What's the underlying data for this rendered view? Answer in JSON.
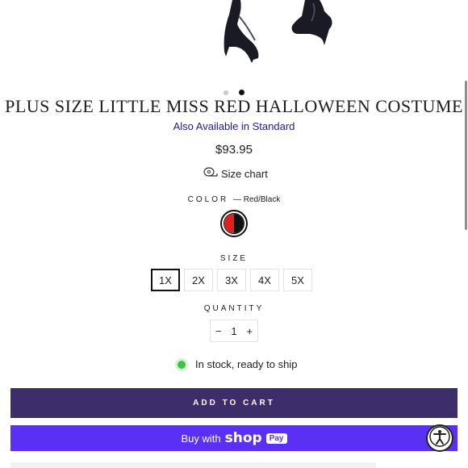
{
  "product": {
    "title": "PLUS SIZE LITTLE MISS RED HALLOWEEN COSTUME",
    "alt_link": "Also Available in Standard",
    "price": "$93.95",
    "size_chart_label": "Size chart"
  },
  "gallery": {
    "slides": 2,
    "active_index": 1
  },
  "color": {
    "label": "COLOR",
    "selected": "— Red/Black",
    "swatch_colors": [
      "#e0201c",
      "#111111"
    ]
  },
  "size": {
    "label": "SIZE",
    "options": [
      "1X",
      "2X",
      "3X",
      "4X",
      "5X"
    ],
    "selected": "1X"
  },
  "quantity": {
    "label": "QUANTITY",
    "minus": "−",
    "value": "1",
    "plus": "+"
  },
  "stock": {
    "text": "In stock, ready to ship"
  },
  "buttons": {
    "add_to_cart": "ADD TO CART",
    "buy_with": "Buy with",
    "shop": "shop",
    "pay": "Pay"
  },
  "icons": {
    "size_chart": "tape-measure-icon",
    "accessibility": "accessibility-icon"
  },
  "colors": {
    "add_to_cart_bg": "#3d2d6b",
    "shop_pay_bg": "#5a31f4",
    "link": "#1d1a9c",
    "in_stock": "#3ec246"
  }
}
